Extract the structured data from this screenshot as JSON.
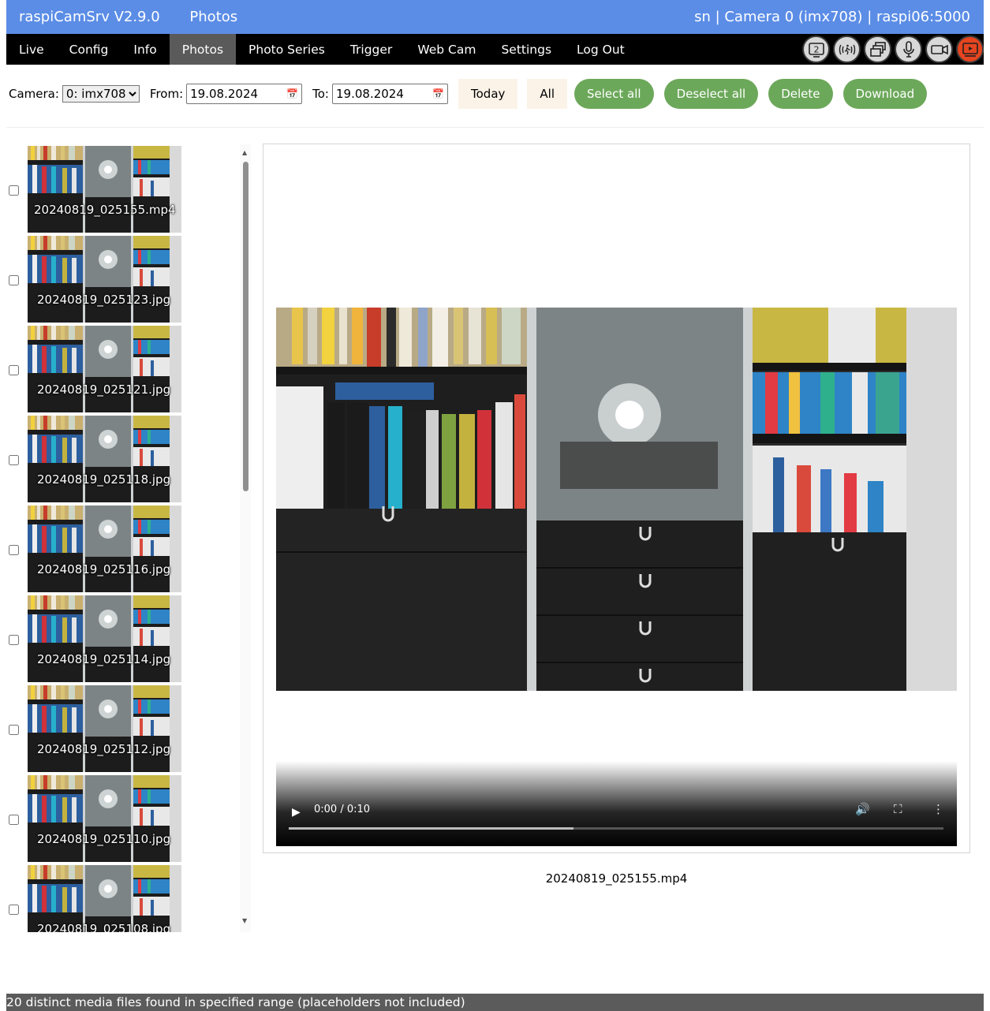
{
  "header": {
    "app_title": "raspiCamSrv V2.9.0",
    "page_title": "Photos",
    "status": "sn | Camera 0 (imx708) | raspi06:5000"
  },
  "nav": {
    "items": [
      {
        "label": "Live",
        "name": "nav-live"
      },
      {
        "label": "Config",
        "name": "nav-config"
      },
      {
        "label": "Info",
        "name": "nav-info"
      },
      {
        "label": "Photos",
        "name": "nav-photos",
        "active": true
      },
      {
        "label": "Photo Series",
        "name": "nav-photo-series"
      },
      {
        "label": "Trigger",
        "name": "nav-trigger"
      },
      {
        "label": "Web Cam",
        "name": "nav-web-cam"
      },
      {
        "label": "Settings",
        "name": "nav-settings"
      },
      {
        "label": "Log Out",
        "name": "nav-log-out"
      }
    ],
    "icons": [
      "camera-2-icon",
      "motion-detection-icon",
      "multi-window-icon",
      "microphone-icon",
      "video-camera-icon",
      "video-recording-icon"
    ],
    "icon_colors": {
      "default": "#d8d8d8",
      "active": "#e5451f"
    }
  },
  "filters": {
    "camera_label": "Camera:",
    "camera_value": "0: imx708",
    "from_label": "From:",
    "from_value": "19.08.2024",
    "to_label": "To:",
    "to_value": "19.08.2024",
    "today_label": "Today",
    "all_label": "All",
    "select_all_label": "Select all",
    "deselect_all_label": "Deselect all",
    "delete_label": "Delete",
    "download_label": "Download"
  },
  "files": [
    "20240819_025155.mp4",
    "20240819_025123.jpg",
    "20240819_025121.jpg",
    "20240819_025118.jpg",
    "20240819_025116.jpg",
    "20240819_025114.jpg",
    "20240819_025112.jpg",
    "20240819_025110.jpg",
    "20240819_025108.jpg"
  ],
  "viewer": {
    "time": "0:00 / 0:10",
    "progress": 0.435,
    "caption": "20240819_025155.mp4"
  },
  "footer": {
    "status": "20 distinct media files found in specified range (placeholders not included)"
  },
  "colors": {
    "header_bg": "#5b8de6",
    "nav_bg": "#000000",
    "button_green": "#6ca85a",
    "footer_bg": "#5b5b5b"
  }
}
